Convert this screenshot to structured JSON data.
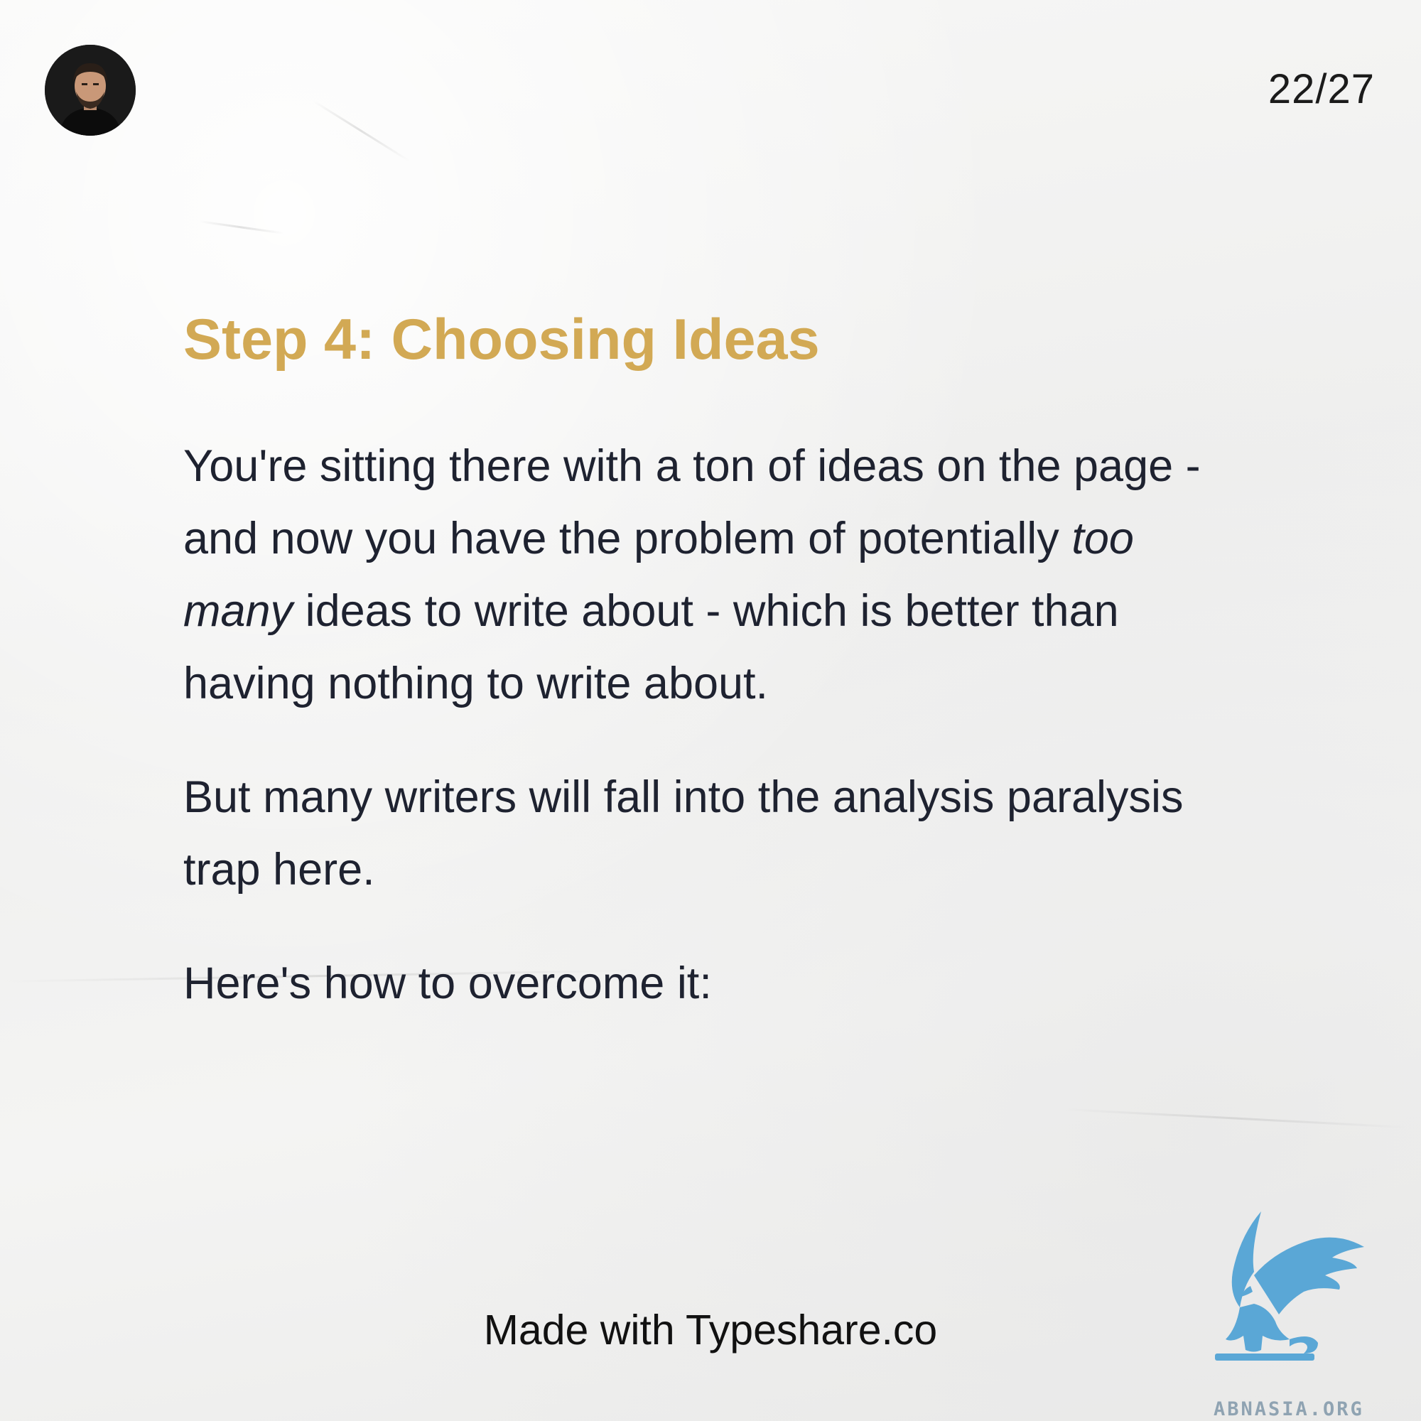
{
  "header": {
    "page_counter": "22/27"
  },
  "slide": {
    "title": "Step 4: Choosing Ideas",
    "paragraph_1": {
      "before_emphasis": "You're sitting there with a ton of ideas on the page - and now you have the problem of potentially ",
      "emphasis": "too many",
      "after_emphasis": " ideas to write about - which is better than having nothing to write about."
    },
    "paragraph_2": "But many writers will fall into the analysis paralysis trap here.",
    "paragraph_3": "Here's how to overcome it:"
  },
  "footer": {
    "credit": "Made with Typeshare.co"
  },
  "watermark": {
    "text": "ABNASIA.ORG",
    "icon": "griffin-icon",
    "color": "#5aa7d6"
  },
  "colors": {
    "title": "#d2a954",
    "body_text": "#1e2230",
    "background": "#f1f1f0"
  }
}
